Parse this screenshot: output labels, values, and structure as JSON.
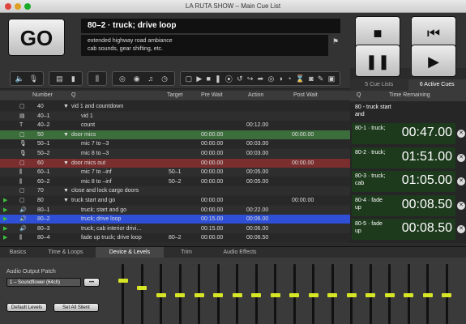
{
  "window": {
    "title": "LA RUTA SHOW – Main Cue List"
  },
  "go_label": "GO",
  "current_cue": {
    "name": "80–2 · truck; drive loop",
    "notes_line1": "extended highway road ambiance",
    "notes_line2": "cab sounds, gear shifting, etc."
  },
  "transport": {
    "stop": "■",
    "back": "⏮",
    "pause": "❚❚",
    "play": "▶"
  },
  "panel_tabs": {
    "cue_lists": "5 Cue Lists",
    "active": "6 Active Cues"
  },
  "columns": {
    "number": "Number",
    "q": "Q",
    "target": "Target",
    "pre_wait": "Pre Wait",
    "action": "Action",
    "post_wait": "Post Wait"
  },
  "rows": [
    {
      "num": "40",
      "q": "vid 1 and countdown",
      "target": "",
      "pre": "",
      "action": "",
      "post": "",
      "type": "group"
    },
    {
      "num": "40–1",
      "q": "vid 1",
      "target": "",
      "pre": "",
      "action": "",
      "post": "",
      "type": "video"
    },
    {
      "num": "40–2",
      "q": "count",
      "target": "",
      "pre": "",
      "action": "00:12.00",
      "post": "",
      "type": "text"
    },
    {
      "num": "50",
      "q": "door mics",
      "target": "",
      "pre": "00:00.00",
      "action": "",
      "post": "00:00.00",
      "type": "group"
    },
    {
      "num": "50–1",
      "q": "mic 7 to –3",
      "target": "",
      "pre": "00:00.00",
      "action": "00:03.00",
      "post": "",
      "type": "mic"
    },
    {
      "num": "50–2",
      "q": "mic 8 to –3",
      "target": "",
      "pre": "00:00.00",
      "action": "00:03.00",
      "post": "",
      "type": "mic"
    },
    {
      "num": "60",
      "q": "door mics out",
      "target": "",
      "pre": "00:00.00",
      "action": "",
      "post": "00:00.00",
      "type": "group"
    },
    {
      "num": "60–1",
      "q": "mic 7 to –inf",
      "target": "50–1",
      "pre": "00:00.00",
      "action": "00:05.00",
      "post": "",
      "type": "fade"
    },
    {
      "num": "60–2",
      "q": "mic 8 to –inf",
      "target": "50–2",
      "pre": "00:00.00",
      "action": "00:05.00",
      "post": "",
      "type": "fade"
    },
    {
      "num": "70",
      "q": "close and lock cargo doors",
      "target": "",
      "pre": "",
      "action": "",
      "post": "",
      "type": "group"
    },
    {
      "num": "80",
      "q": "truck start and go",
      "target": "",
      "pre": "00:00.00",
      "action": "",
      "post": "00:00.00",
      "type": "group"
    },
    {
      "num": "80–1",
      "q": "truck; start and go",
      "target": "",
      "pre": "00:00.00",
      "action": "00:22.00",
      "post": "",
      "type": "audio"
    },
    {
      "num": "80–2",
      "q": "truck; drive loop",
      "target": "",
      "pre": "00:15.00",
      "action": "00:06.00",
      "post": "",
      "type": "audio"
    },
    {
      "num": "80–3",
      "q": "truck; cab interior drivi...",
      "target": "",
      "pre": "00:15.00",
      "action": "00:06.00",
      "post": "",
      "type": "audio"
    },
    {
      "num": "80–4",
      "q": "fade up truck; drive loop",
      "target": "80–2",
      "pre": "00:00.00",
      "action": "00:06.50",
      "post": "",
      "type": "fade"
    }
  ],
  "side": {
    "q": "Q",
    "time_remaining": "Time Remaining",
    "header_cue": "80 - truck start and"
  },
  "active_cues": [
    {
      "name": "80-1 · truck;",
      "time": "00:47.00"
    },
    {
      "name": "80-2 · truck;",
      "time": "01:51.00"
    },
    {
      "name": "80-3 · truck; cab",
      "time": "01:05.00"
    },
    {
      "name": "80-4 · fade up",
      "time": "00:08.50"
    },
    {
      "name": "80-5 · fade up",
      "time": "00:08.50"
    }
  ],
  "bottom_tabs": [
    "Basics",
    "Time & Loops",
    "Device & Levels",
    "Trim",
    "Audio Effects"
  ],
  "device": {
    "output_label": "Audio Output Patch",
    "output_value": "1 – Soundflower (64ch)",
    "more": "•••",
    "default_levels": "Default Levels",
    "set_all_silent": "Set All Silent"
  },
  "colors": {
    "selected_row": "#2e4fd6",
    "green_row": "#3c6e3c",
    "red_row": "#7a2e2e",
    "fader_knob": "#d6e626"
  }
}
